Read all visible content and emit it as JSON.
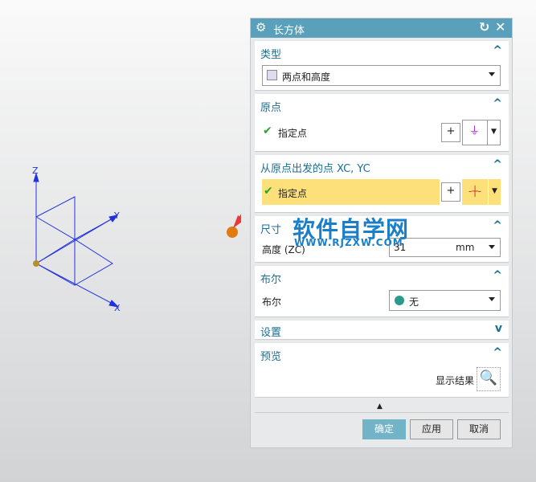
{
  "axes": {
    "z": "Z",
    "y": "Y",
    "x": "X"
  },
  "dialog": {
    "title": "长方体",
    "type": {
      "header": "类型",
      "value": "两点和高度"
    },
    "origin": {
      "header": "原点",
      "label": "指定点"
    },
    "from_origin": {
      "header": "从原点出发的点 XC, YC",
      "label": "指定点"
    },
    "size": {
      "header": "尺寸",
      "label": "高度 (ZC)",
      "value": "31",
      "unit": "mm"
    },
    "boolean": {
      "header": "布尔",
      "label": "布尔",
      "value": "无"
    },
    "settings": {
      "header": "设置"
    },
    "preview": {
      "header": "预览",
      "label": "显示结果"
    },
    "buttons": {
      "ok": "确定",
      "apply": "应用",
      "cancel": "取消"
    }
  },
  "watermark": {
    "title": "软件自学网",
    "url": "WWW.RJZXW.COM"
  },
  "colors": {
    "title_bar": "#5aa0ba",
    "highlight": "#fde07a",
    "header_text": "#1b6f92"
  }
}
